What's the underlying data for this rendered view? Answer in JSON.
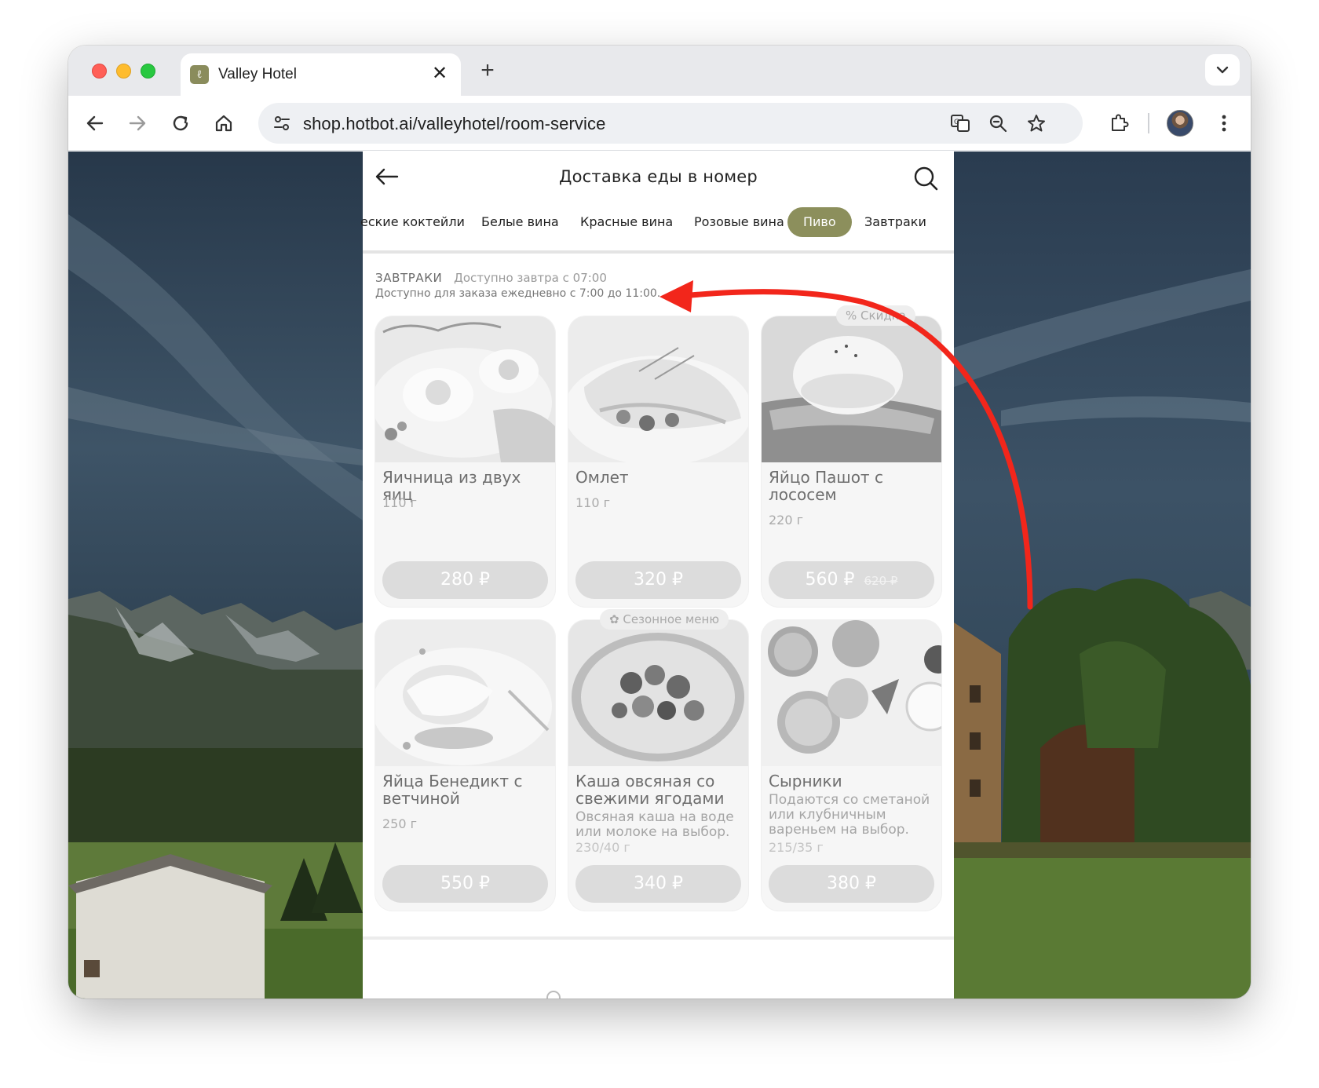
{
  "browser": {
    "tab_title": "Valley Hotel",
    "tab_favicon": "ℓ",
    "url": "shop.hotbot.ai/valleyhotel/room-service",
    "close_glyph": "✕",
    "new_tab_glyph": "+"
  },
  "page": {
    "title": "Доставка еды в номер",
    "categories": [
      {
        "label": "еские коктейли",
        "active": false
      },
      {
        "label": "Белые вина",
        "active": false
      },
      {
        "label": "Красные вина",
        "active": false
      },
      {
        "label": "Розовые вина",
        "active": false
      },
      {
        "label": "Пиво",
        "active": true
      },
      {
        "label": "Завтраки",
        "active": false
      }
    ],
    "section": {
      "title": "ЗАВТРАКИ",
      "availability": "Доступно завтра с 07:00",
      "subtitle": "Доступно для заказа ежедневно с 7:00 до 11:00."
    },
    "badges": {
      "discount": "Скидка",
      "seasonal": "Сезонное меню"
    },
    "items": [
      {
        "name": "Яичница из двух яиц",
        "weight": "110 г",
        "price": "280 ₽"
      },
      {
        "name": "Омлет",
        "weight": "110 г",
        "price": "320 ₽"
      },
      {
        "name": "Яйцо Пашот с лососем",
        "weight": "220 г",
        "price": "560 ₽",
        "old_price": "620 ₽"
      },
      {
        "name": "Яйца Бенедикт с ветчиной",
        "weight": "250 г",
        "price": "550 ₽"
      },
      {
        "name": "Каша овсяная со свежими ягодами",
        "description": "Овсяная каша на воде или молоке на выбор.",
        "weight": "230/40 г",
        "price": "340 ₽"
      },
      {
        "name": "Сырники",
        "description": "Подаются со сметаной или клубничным вареньем на выбор.",
        "weight": "215/35 г",
        "price": "380 ₽"
      }
    ]
  },
  "colors": {
    "accent": "#8c8f5c",
    "annotation": "#f2261b",
    "price_button": "#dcdcdc"
  }
}
